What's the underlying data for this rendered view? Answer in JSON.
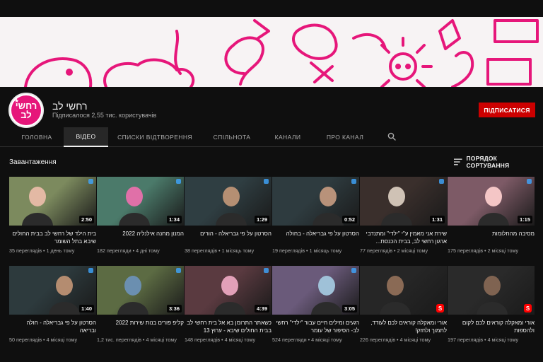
{
  "channel": {
    "name": "רחשי לב",
    "subscribers": "Підписалося 2,55 тис. користувачів",
    "avatar_line1": "רחשי",
    "avatar_line2": "לב",
    "subscribe_label": "ПІДПИСАТИСЯ"
  },
  "tabs": [
    {
      "label": "ГОЛОВНА",
      "active": false
    },
    {
      "label": "ВІДЕО",
      "active": true
    },
    {
      "label": "СПИСКИ ВІДТВОРЕННЯ",
      "active": false
    },
    {
      "label": "СПІЛЬНОТА",
      "active": false
    },
    {
      "label": "КАНАЛИ",
      "active": false
    },
    {
      "label": "ПРО КАНАЛ",
      "active": false
    }
  ],
  "section": {
    "title": "Завантаження",
    "sort_label": "ПОРЯДОК СОРТУВАННЯ"
  },
  "videos": [
    {
      "title": "בית הילד של רחשי לב בבית החולים שיבא בתל השומר",
      "duration": "2:50",
      "views": "35 переглядів",
      "age": "1 день тому",
      "thumb_bg": "#7c8a5e",
      "thumb_fg": "#e3b9a4"
    },
    {
      "title": "המנון מחנה אילנליה 2022",
      "duration": "1:34",
      "views": "182 перегляди",
      "age": "4 дні тому",
      "thumb_bg": "#4b7a6a",
      "thumb_fg": "#e070a8"
    },
    {
      "title": "הסרטון על פי גבריאלה - הורים",
      "duration": "1:29",
      "views": "38 переглядів",
      "age": "1 місяць тому",
      "thumb_bg": "#2f3e42",
      "thumb_fg": "#b58f73"
    },
    {
      "title": "הסרטון על פי גבריאלה - בחולה",
      "duration": "0:52",
      "views": "19 переглядів",
      "age": "1 місяць тому",
      "thumb_bg": "#2e3b3f",
      "thumb_fg": "#b8927a"
    },
    {
      "title": "שירת אני מאמין ע\"י \"ילדי\" ומתנדבי ארגון רחשי לב, בבית הכנסת...",
      "duration": "1:31",
      "views": "77 переглядів",
      "age": "2 місяці тому",
      "thumb_bg": "#3a2f2c",
      "thumb_fg": "#cfc2b5"
    },
    {
      "title": "מסיבה מהחלומות",
      "duration": "1:15",
      "views": "175 переглядів",
      "age": "2 місяці тому",
      "thumb_bg": "#7d5a66",
      "thumb_fg": "#f4c6c6"
    },
    {
      "title": "הסרטון על פי גבריאלה - חולה ובריאה",
      "duration": "1:40",
      "views": "50 переглядів",
      "age": "4 місяці тому",
      "thumb_bg": "#2d3a3d",
      "thumb_fg": "#b48c70"
    },
    {
      "title": "קליפ פורים בנות שירות 2022",
      "duration": "3:36",
      "views": "1,2 тис. переглядів",
      "age": "4 місяці тому",
      "thumb_bg": "#5c6b43",
      "thumb_fg": "#6b8fb0"
    },
    {
      "title": "כשאתר התרומן בא אל בית רחשי לב בבית החולים שיבא - ערוץ 13",
      "duration": "4:39",
      "views": "148 переглядів",
      "age": "4 місяці тому",
      "thumb_bg": "#5a3a40",
      "thumb_fg": "#e2a0b8"
    },
    {
      "title": "רגעים ומילים חיים עבור \"ילדי\" רחשי לב- הסיפור של עומר",
      "duration": "3:05",
      "views": "524 перегляди",
      "age": "4 місяці тому",
      "thumb_bg": "#6a5a7a",
      "thumb_fg": "#9fc1d8"
    },
    {
      "title": "אורי ומאקלה קוראים לכם לעודד, לתמוך ולחזק!",
      "duration": "",
      "views": "226 переглядів",
      "age": "4 місяці тому",
      "thumb_bg": "#262626",
      "thumb_fg": "#8a6a55",
      "shorts": true
    },
    {
      "title": "אורי ומאקלה קוראים לכם לקום ולהספות",
      "duration": "",
      "views": "197 переглядів",
      "age": "4 місяці тому",
      "thumb_bg": "#2a2a2a",
      "thumb_fg": "#7f6351",
      "shorts": true
    }
  ],
  "colors": {
    "background": "#0f0f0f",
    "subscribe": "#cc0000",
    "banner_art": "#e6167a",
    "secondary_text": "#aaaaaa"
  },
  "icons": {
    "search": "search-icon",
    "sort": "sort-icon",
    "shorts": "shorts-icon"
  }
}
